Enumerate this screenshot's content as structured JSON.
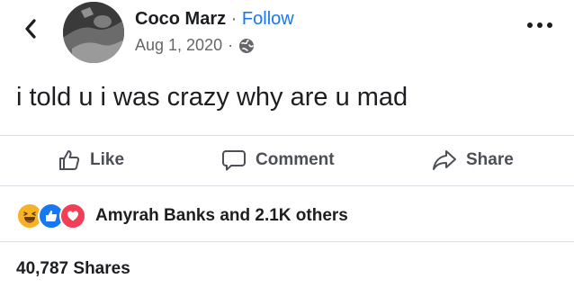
{
  "header": {
    "author_name": "Coco Marz",
    "separator": "·",
    "follow_label": "Follow",
    "date": "Aug 1, 2020",
    "date_separator": "·",
    "privacy_icon": "globe-icon",
    "back_icon": "chevron-left-icon",
    "more_icon": "more-horizontal-icon"
  },
  "post": {
    "text": "i told u i was crazy why are u mad"
  },
  "actions": {
    "like_label": "Like",
    "comment_label": "Comment",
    "share_label": "Share"
  },
  "reactions": {
    "icons": [
      "haha-icon",
      "like-icon",
      "love-icon"
    ],
    "summary": "Amyrah Banks and 2.1K others"
  },
  "shares": {
    "label": "40,787 Shares"
  },
  "colors": {
    "accent": "#1877f2",
    "like": "#1877f2",
    "love": "#f33e58",
    "haha": "#f7b125",
    "secondary_text": "#65676b"
  }
}
